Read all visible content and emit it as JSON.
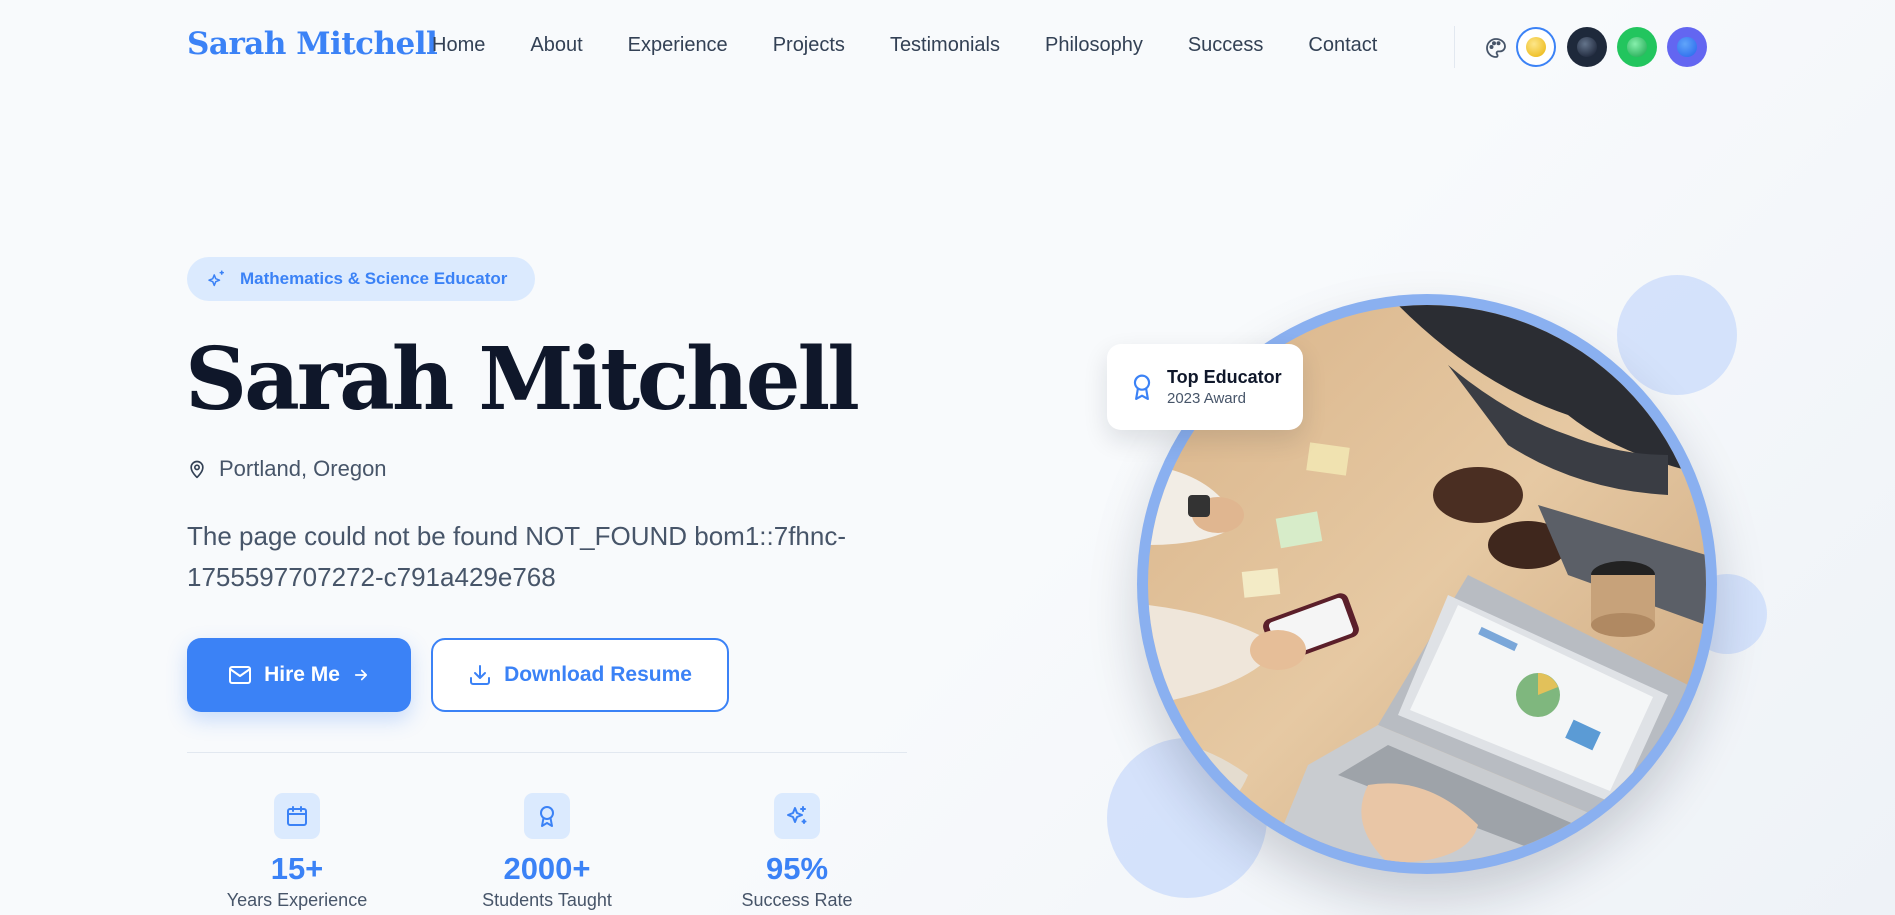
{
  "nav": {
    "brand": "Sarah Mitchell",
    "links": [
      "Home",
      "About",
      "Experience",
      "Projects",
      "Testimonials",
      "Philosophy",
      "Success",
      "Contact"
    ],
    "theme_icon": "palette-icon",
    "themes": [
      {
        "name": "light",
        "color": "#eab308",
        "active": true
      },
      {
        "name": "dark",
        "color": "#1e293b",
        "active": false
      },
      {
        "name": "green",
        "color": "#22c55e",
        "active": false
      },
      {
        "name": "indigo",
        "color": "#6366f1",
        "active": false
      }
    ]
  },
  "hero": {
    "badge": "Mathematics & Science Educator",
    "badge_icon": "sparkles-icon",
    "title": "Sarah Mitchell",
    "location": "Portland, Oregon",
    "location_icon": "map-pin-icon",
    "tagline": "The page could not be found NOT_FOUND bom1::7fhnc-1755597707272-c791a429e768",
    "primary_button": "Hire Me",
    "secondary_button": "Download Resume",
    "stats": [
      {
        "icon": "calendar-icon",
        "value": "15+",
        "label": "Years Experience"
      },
      {
        "icon": "award-icon",
        "value": "2000+",
        "label": "Students Taught"
      },
      {
        "icon": "sparkles-icon",
        "value": "95%",
        "label": "Success Rate"
      }
    ],
    "award": {
      "title": "Top Educator",
      "subtitle": "2023 Award",
      "icon": "award-icon"
    }
  },
  "colors": {
    "accent": "#3b82f6",
    "accent_light": "#dbeafe",
    "heading": "#0f172a",
    "body": "#475569"
  }
}
